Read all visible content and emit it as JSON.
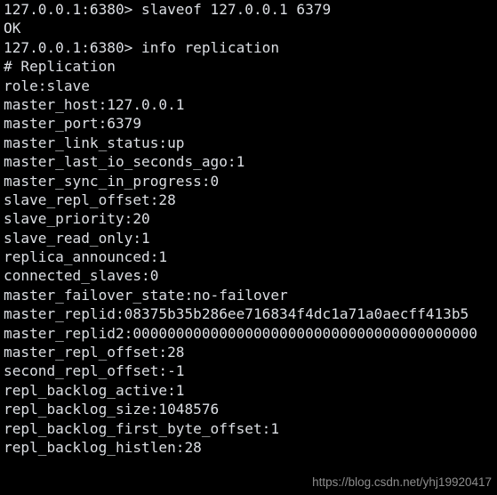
{
  "terminal": {
    "background_color": "#000000",
    "text_color": "#dcdfe4",
    "lines": [
      "127.0.0.1:6380> slaveof 127.0.0.1 6379",
      "OK",
      "127.0.0.1:6380> info replication",
      "# Replication",
      "role:slave",
      "master_host:127.0.0.1",
      "master_port:6379",
      "master_link_status:up",
      "master_last_io_seconds_ago:1",
      "master_sync_in_progress:0",
      "slave_repl_offset:28",
      "slave_priority:20",
      "slave_read_only:1",
      "replica_announced:1",
      "connected_slaves:0",
      "master_failover_state:no-failover",
      "master_replid:08375b35b286ee716834f4dc1a71a0aecff413b5",
      "master_replid2:0000000000000000000000000000000000000000",
      "master_repl_offset:28",
      "second_repl_offset:-1",
      "repl_backlog_active:1",
      "repl_backlog_size:1048576",
      "repl_backlog_first_byte_offset:1",
      "repl_backlog_histlen:28"
    ]
  },
  "watermark": {
    "text": "https://blog.csdn.net/yhj19920417",
    "color": "#8d8d8d"
  }
}
